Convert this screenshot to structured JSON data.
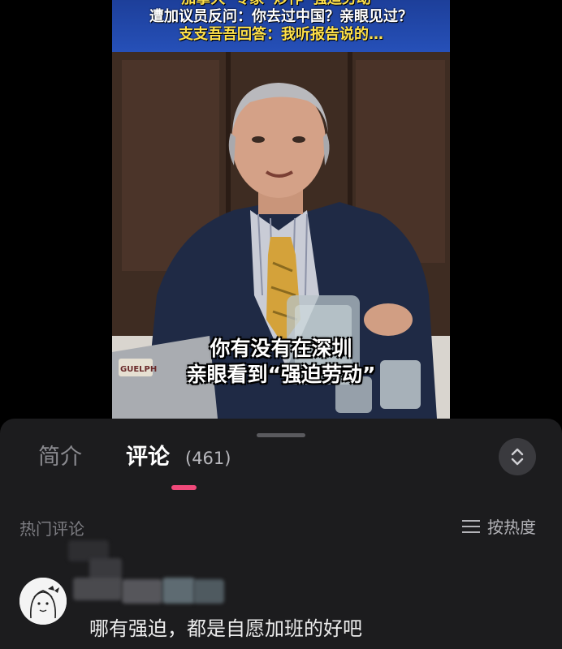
{
  "video": {
    "title_lines": [
      "加拿大“专家”炒作“强迫劳动”",
      "遭加议员反问：你去过中国？亲眼见过？",
      "支支吾吾回答：我听报告说的…"
    ],
    "subtitle_lines": [
      "你有没有在深圳",
      "亲眼看到“强迫劳动”"
    ],
    "laptop_sticker_text": "GUELPH"
  },
  "sheet": {
    "tabs": [
      {
        "label": "简介",
        "active": false
      },
      {
        "label": "评论",
        "active": true,
        "count": "(461)"
      }
    ],
    "accent_color": "#f0497a",
    "expand_icon": "chevron-up-down-icon",
    "section_label": "热门评论",
    "sort_label": "按热度",
    "sort_icon": "menu-lines-icon"
  },
  "comments": [
    {
      "text": "哪有强迫，都是自愿加班的好吧",
      "avatar": "cartoon-girl-avatar"
    }
  ]
}
